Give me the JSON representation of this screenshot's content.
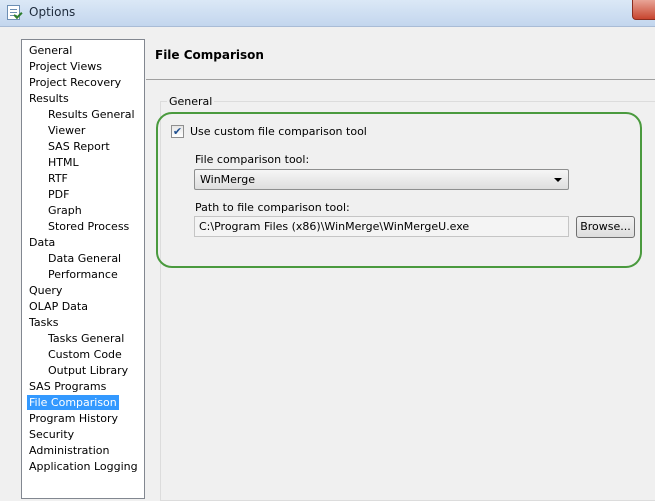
{
  "window": {
    "title": "Options"
  },
  "nav": {
    "items": [
      {
        "label": "General",
        "key": "general"
      },
      {
        "label": "Project Views",
        "key": "project-views"
      },
      {
        "label": "Project Recovery",
        "key": "project-recovery"
      },
      {
        "label": "Results",
        "key": "results"
      },
      {
        "label": "Results General",
        "key": "results-general"
      },
      {
        "label": "Viewer",
        "key": "viewer"
      },
      {
        "label": "SAS Report",
        "key": "sas-report"
      },
      {
        "label": "HTML",
        "key": "html"
      },
      {
        "label": "RTF",
        "key": "rtf"
      },
      {
        "label": "PDF",
        "key": "pdf"
      },
      {
        "label": "Graph",
        "key": "graph"
      },
      {
        "label": "Stored Process",
        "key": "stored-process"
      },
      {
        "label": "Data",
        "key": "data"
      },
      {
        "label": "Data General",
        "key": "data-general"
      },
      {
        "label": "Performance",
        "key": "performance"
      },
      {
        "label": "Query",
        "key": "query"
      },
      {
        "label": "OLAP Data",
        "key": "olap-data"
      },
      {
        "label": "Tasks",
        "key": "tasks"
      },
      {
        "label": "Tasks General",
        "key": "tasks-general"
      },
      {
        "label": "Custom Code",
        "key": "custom-code"
      },
      {
        "label": "Output Library",
        "key": "output-library"
      },
      {
        "label": "SAS Programs",
        "key": "sas-programs"
      },
      {
        "label": "File Comparison",
        "key": "file-comparison"
      },
      {
        "label": "Program History",
        "key": "program-history"
      },
      {
        "label": "Security",
        "key": "security"
      },
      {
        "label": "Administration",
        "key": "administration"
      },
      {
        "label": "Application Logging",
        "key": "application-logging"
      }
    ],
    "selected": "File Comparison"
  },
  "page": {
    "title": "File Comparison",
    "section_label": "General",
    "use_custom_tool": {
      "label": "Use custom file comparison tool",
      "checked": true
    },
    "tool_label": "File comparison tool:",
    "tool_value": "WinMerge",
    "path_label": "Path to file comparison tool:",
    "path_value": "C:\\Program Files (x86)\\WinMerge\\WinMergeU.exe",
    "browse_label": "Browse..."
  },
  "colors": {
    "selection": "#3399ff",
    "highlight_ring": "#4a9a3e"
  }
}
